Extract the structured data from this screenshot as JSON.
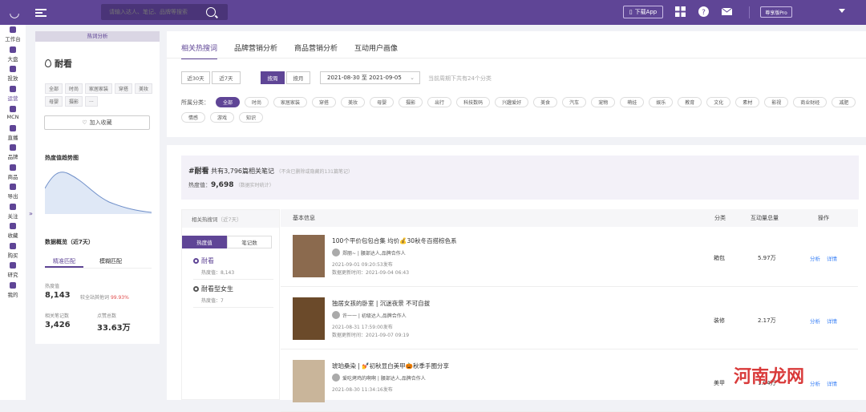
{
  "search": {
    "placeholder": "请输入达人、笔记、品牌等搜索"
  },
  "header": {
    "download": "下载App",
    "vip": "尊享版Pro"
  },
  "nav": [
    "工作台",
    "大盘",
    "投放",
    "运营",
    "MCN",
    "直播",
    "品牌",
    "商品",
    "导出",
    "关注",
    "收藏",
    "购买",
    "研究",
    "我的"
  ],
  "left": {
    "head": "热词分析",
    "keyword": "耐看",
    "tags": [
      "全部",
      "时尚",
      "家居家装",
      "穿搭",
      "美妆",
      "母婴",
      "摄影",
      "..."
    ],
    "fav": "加入收藏",
    "trend_title": "热度值趋势图",
    "overview": "数据概览（近7天）",
    "tab1": "精准匹配",
    "tab2": "模糊匹配",
    "heat_label": "热度值",
    "heat_val": "8,143",
    "heat_note": "较全站其他词",
    "heat_pct": "99.93%",
    "notes_label": "相关笔记数",
    "notes_val": "3,426",
    "likes_label": "点赞总数",
    "likes_val": "33.63万"
  },
  "main": {
    "tabs": [
      "相关热搜词",
      "品牌营销分析",
      "商品营销分析",
      "互动用户画像"
    ],
    "b30": "近30天",
    "b7": "近7天",
    "bweek": "按周",
    "bmonth": "按月",
    "date": "2021-08-30 至 2021-09-05",
    "datenote": "当前周期下共有24个分类",
    "catlabel": "所属分类：",
    "cats": [
      "全部",
      "时尚",
      "家居家装",
      "穿搭",
      "美妆",
      "母婴",
      "摄影",
      "出行",
      "科技数码",
      "兴趣爱好",
      "美食",
      "汽车",
      "宠物",
      "萌娃",
      "娱乐",
      "教育",
      "文化",
      "素材",
      "影视",
      "商业财经",
      "减肥",
      "情感",
      "游戏",
      "知识"
    ]
  },
  "kw": {
    "name": "#耐看",
    "desc": "共有3,796篇相关笔记",
    "note": "（不含已删除或隐藏的131篇笔记）",
    "heat_label": "热度值：",
    "heat": "9,698",
    "heat_note": "（数据实时统计）"
  },
  "rel": {
    "head": "相关热搜词",
    "head_note": "（近7天）",
    "tab1": "热度值",
    "tab2": "笔记数",
    "items": [
      {
        "name": "耐看",
        "heat": "热度值：8,143"
      },
      {
        "name": "耐看型女生",
        "heat": "热度值：7"
      }
    ]
  },
  "table": {
    "cols": [
      "基本信息",
      "分类",
      "互动量总量",
      "操作"
    ],
    "rows": [
      {
        "title": "100个平价包包合集 均价💰30秋冬百搭棕色系",
        "author": "郑丽~ | 腰部达人,品牌合作人",
        "pub": "2021-09-01 09:20:53发布",
        "upd": "数据更新时间：2021-09-04 06:43",
        "cat": "箱包",
        "val": "5.97万",
        "op1": "分析",
        "op2": "详情"
      },
      {
        "title": "独居女孩的卧室 | 沉迷夜景 不可自拔",
        "author": "许一一 | 初级达人,品牌合作人",
        "pub": "2021-08-31 17:59:00发布",
        "upd": "数据更新时间：2021-09-07 09:19",
        "cat": "装修",
        "val": "2.17万",
        "op1": "分析",
        "op2": "详情"
      },
      {
        "title": "琥珀桑染 | 💅初秋显白美甲🎃秋季手圈分享",
        "author": "爱吃烤鸡的啊啊 | 腰部达人,品牌合作人",
        "pub": "2021-08-30 11:34:16发布",
        "upd": "",
        "cat": "美甲",
        "val": "1.94万",
        "op1": "分析",
        "op2": "详情"
      }
    ]
  },
  "watermark": "河南龙网"
}
